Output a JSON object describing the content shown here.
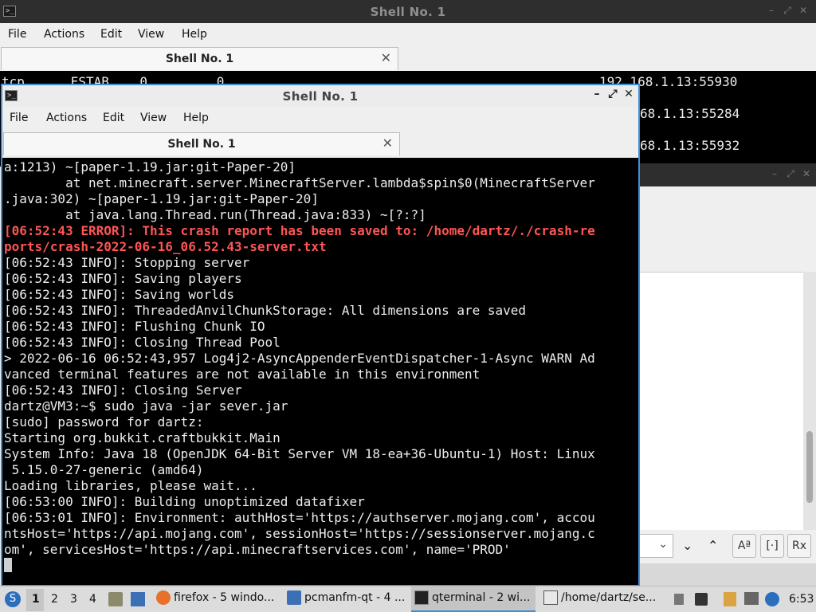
{
  "bg_window": {
    "title": "Shell No. 1",
    "icon": ">_",
    "controls": [
      "–",
      "⤢",
      "✕"
    ],
    "menu": [
      "File",
      "Actions",
      "Edit",
      "View",
      "Help"
    ],
    "tab": {
      "label": "Shell No. 1",
      "close": "✕"
    },
    "term_lines": [
      {
        "left": "tcp      ESTAB    0         0",
        "right": "192.168.1.13:55930"
      },
      {
        "left": "",
        "right": "68.1.13:55284"
      },
      {
        "left": "",
        "right": "68.1.13:55932"
      }
    ]
  },
  "side_window": {
    "controls": [
      "–",
      "⤢",
      "✕"
    ],
    "find_combo_arrow": "⌄",
    "find_down": "⌄",
    "find_up": "⌃",
    "buttons": [
      "Aª",
      "[·]",
      "Rx"
    ]
  },
  "fg_window": {
    "title": "Shell No. 1",
    "icon": ">_",
    "controls": [
      "–",
      "⤢",
      "✕"
    ],
    "menu": [
      "File",
      "Actions",
      "Edit",
      "View",
      "Help"
    ],
    "tab": {
      "label": "Shell No. 1",
      "close": "✕"
    },
    "lines": [
      {
        "text": "a:1213) ~[paper-1.19.jar:git-Paper-20]",
        "type": "normal"
      },
      {
        "text": "        at net.minecraft.server.MinecraftServer.lambda$spin$0(MinecraftServer",
        "type": "normal"
      },
      {
        "text": ".java:302) ~[paper-1.19.jar:git-Paper-20]",
        "type": "normal"
      },
      {
        "text": "        at java.lang.Thread.run(Thread.java:833) ~[?:?]",
        "type": "normal"
      },
      {
        "text": "[06:52:43 ERROR]: This crash report has been saved to: /home/dartz/./crash-re",
        "type": "err"
      },
      {
        "text": "ports/crash-2022-06-16_06.52.43-server.txt",
        "type": "err"
      },
      {
        "text": "[06:52:43 INFO]: Stopping server",
        "type": "normal"
      },
      {
        "text": "[06:52:43 INFO]: Saving players",
        "type": "normal"
      },
      {
        "text": "[06:52:43 INFO]: Saving worlds",
        "type": "normal"
      },
      {
        "text": "[06:52:43 INFO]: ThreadedAnvilChunkStorage: All dimensions are saved",
        "type": "normal"
      },
      {
        "text": "[06:52:43 INFO]: Flushing Chunk IO",
        "type": "normal"
      },
      {
        "text": "[06:52:43 INFO]: Closing Thread Pool",
        "type": "normal"
      },
      {
        "text": "> 2022-06-16 06:52:43,957 Log4j2-AsyncAppenderEventDispatcher-1-Async WARN Ad",
        "type": "normal"
      },
      {
        "text": "vanced terminal features are not available in this environment",
        "type": "normal"
      },
      {
        "text": "[06:52:43 INFO]: Closing Server",
        "type": "normal"
      },
      {
        "text": "dartz@VM3:~$ sudo java -jar sever.jar",
        "type": "normal"
      },
      {
        "text": "[sudo] password for dartz:",
        "type": "normal"
      },
      {
        "text": "Starting org.bukkit.craftbukkit.Main",
        "type": "normal"
      },
      {
        "text": "System Info: Java 18 (OpenJDK 64-Bit Server VM 18-ea+36-Ubuntu-1) Host: Linux",
        "type": "normal"
      },
      {
        "text": " 5.15.0-27-generic (amd64)",
        "type": "normal"
      },
      {
        "text": "Loading libraries, please wait...",
        "type": "normal"
      },
      {
        "text": "[06:53:00 INFO]: Building unoptimized datafixer",
        "type": "normal"
      },
      {
        "text": "[06:53:01 INFO]: Environment: authHost='https://authserver.mojang.com', accou",
        "type": "normal"
      },
      {
        "text": "ntsHost='https://api.mojang.com', sessionHost='https://sessionserver.mojang.c",
        "type": "normal"
      },
      {
        "text": "om', servicesHost='https://api.minecraftservices.com', name='PROD'",
        "type": "normal"
      }
    ]
  },
  "taskbar": {
    "start_icon": "S",
    "workspaces": [
      "1",
      "2",
      "3",
      "4"
    ],
    "tasks": [
      {
        "label": "firefox - 5 windo...",
        "icon": "firefox-icon",
        "color": "#e8702a"
      },
      {
        "label": "pcmanfm-qt - 4 ...",
        "icon": "folder-icon",
        "color": "#3b6fb6"
      },
      {
        "label": "qterminal - 2 wi...",
        "icon": "terminal-icon",
        "color": "#222222"
      },
      {
        "label": "/home/dartz/se...",
        "icon": "text-editor-icon",
        "color": "#555555"
      }
    ],
    "clock": "6:53"
  }
}
